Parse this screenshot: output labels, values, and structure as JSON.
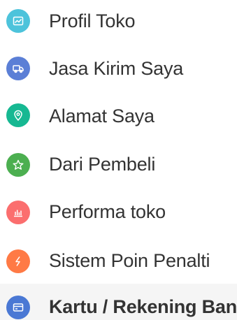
{
  "menu": {
    "items": [
      {
        "label": "Profil Toko",
        "icon": "store-profile-icon",
        "color": "#4dc3db"
      },
      {
        "label": "Jasa Kirim Saya",
        "icon": "delivery-truck-icon",
        "color": "#5b7fd6"
      },
      {
        "label": "Alamat Saya",
        "icon": "location-pin-icon",
        "color": "#16b892"
      },
      {
        "label": "Dari Pembeli",
        "icon": "star-icon",
        "color": "#4caf50"
      },
      {
        "label": "Performa toko",
        "icon": "bar-chart-icon",
        "color": "#fb6e6e"
      },
      {
        "label": "Sistem Poin Penalti",
        "icon": "lightning-icon",
        "color": "#ff7a45"
      },
      {
        "label": "Kartu / Rekening Bank",
        "icon": "bank-card-icon",
        "color": "#4a78d4"
      }
    ]
  }
}
